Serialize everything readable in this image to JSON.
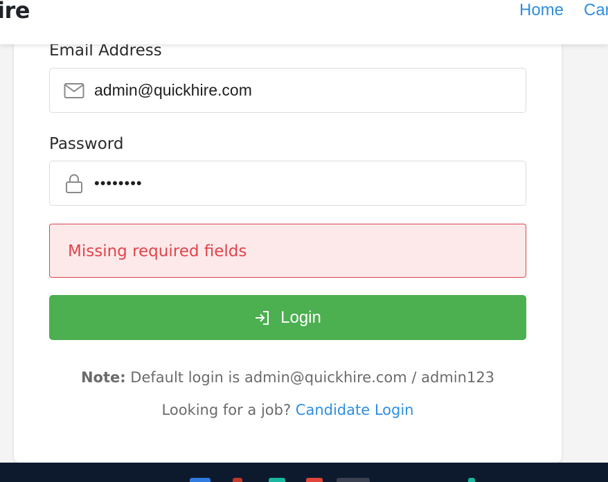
{
  "navbar": {
    "brand": "ire",
    "links": [
      {
        "label": "Home"
      },
      {
        "label": "Car"
      }
    ]
  },
  "form": {
    "email": {
      "label": "Email Address",
      "value": "admin@quickhire.com",
      "icon": "envelope-icon"
    },
    "password": {
      "label": "Password",
      "value": "••••••••",
      "icon": "lock-icon"
    },
    "error": "Missing required fields",
    "submit": {
      "label": "Login",
      "icon": "login-arrow-icon"
    }
  },
  "note": {
    "prefix": "Note:",
    "text": " Default login is admin@quickhire.com / admin123"
  },
  "candidate": {
    "text": "Looking for a job? ",
    "link": "Candidate Login"
  },
  "colors": {
    "accent": "#2f8ee0",
    "success": "#4caf50",
    "error": "#e0444a",
    "error_bg": "#fde9ea"
  }
}
